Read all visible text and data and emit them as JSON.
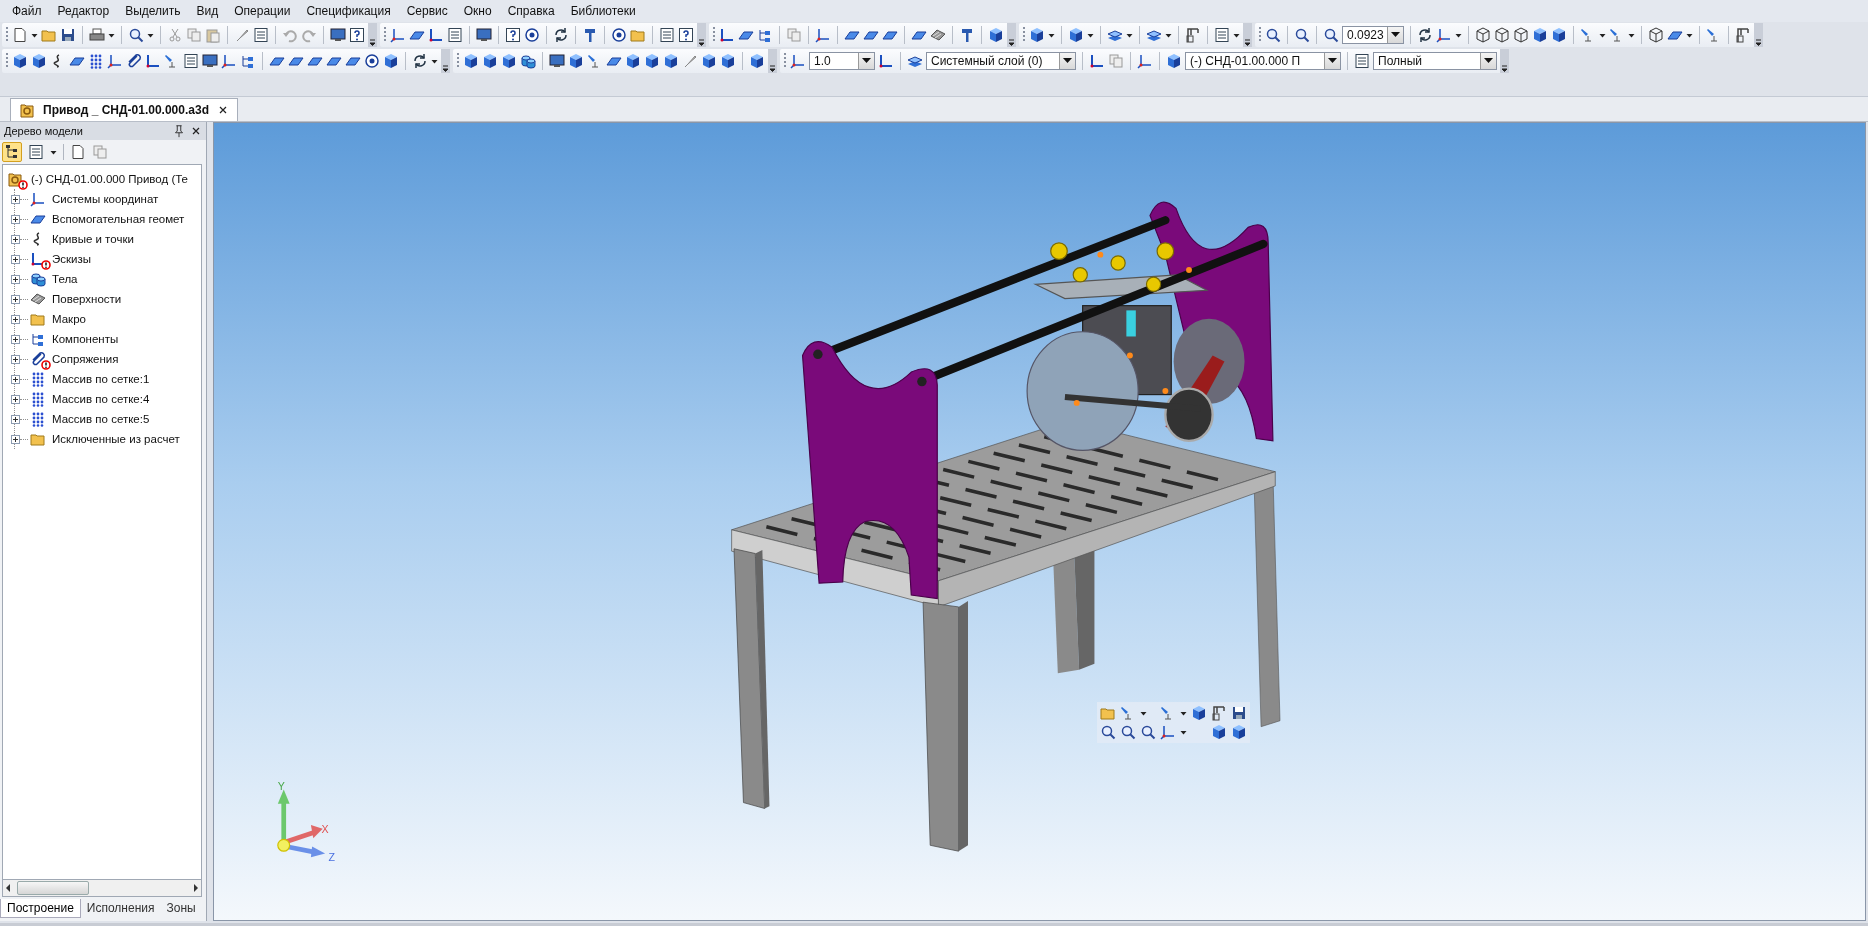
{
  "menu": [
    "Файл",
    "Редактор",
    "Выделить",
    "Вид",
    "Операции",
    "Спецификация",
    "Сервис",
    "Окно",
    "Справка",
    "Библиотеки"
  ],
  "toolbars": {
    "zoom": "0.0923",
    "line_scale": "1.0",
    "layer": "Системный слой (0)",
    "component": "(-) СНД-01.00.000 П",
    "display_mode": "Полный"
  },
  "document_tabs": [
    {
      "title": "Привод _ СНД-01.00.000.a3d",
      "selected": true
    }
  ],
  "tree_panel": {
    "title": "Дерево модели",
    "root": {
      "label": "(-) СНД-01.00.000 Привод (Те",
      "warning": true,
      "children": [
        {
          "label": "Системы координат",
          "expanded": false,
          "warning": false
        },
        {
          "label": "Вспомогательная геомет",
          "expanded": false,
          "warning": false
        },
        {
          "label": "Кривые и точки",
          "expanded": false,
          "warning": false
        },
        {
          "label": "Эскизы",
          "expanded": false,
          "warning": true
        },
        {
          "label": "Тела",
          "expanded": false,
          "warning": false
        },
        {
          "label": "Поверхности",
          "expanded": false,
          "warning": false
        },
        {
          "label": "Макро",
          "expanded": false,
          "warning": false
        },
        {
          "label": "Компоненты",
          "expanded": false,
          "warning": false
        },
        {
          "label": "Сопряжения",
          "expanded": false,
          "warning": true
        },
        {
          "label": "Массив по сетке:1",
          "expanded": false,
          "warning": false
        },
        {
          "label": "Массив по сетке:4",
          "expanded": false,
          "warning": false
        },
        {
          "label": "Массив по сетке:5",
          "expanded": false,
          "warning": false
        },
        {
          "label": "Исключенные из расчет",
          "expanded": false,
          "warning": false
        }
      ]
    },
    "bottom_tabs": [
      {
        "label": "Построение",
        "selected": true
      },
      {
        "label": "Исполнения",
        "selected": false
      },
      {
        "label": "Зоны",
        "selected": false
      }
    ]
  },
  "viewport": {
    "axes": {
      "x": "X",
      "y": "Y",
      "z": "Z"
    }
  }
}
